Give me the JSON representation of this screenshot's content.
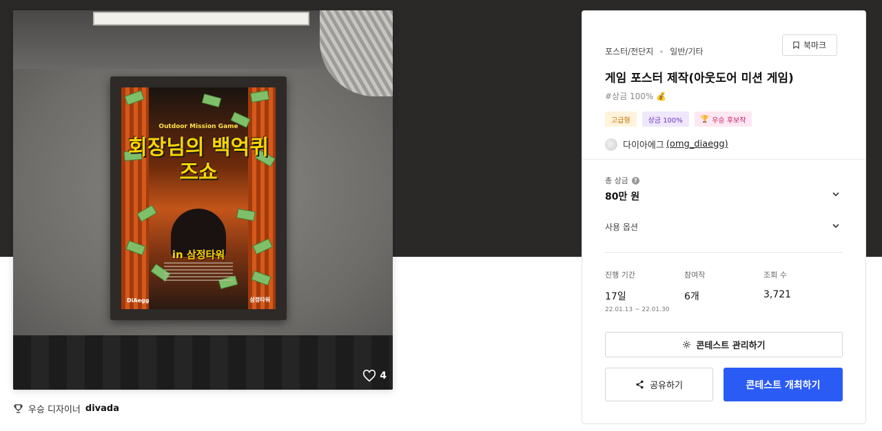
{
  "poster": {
    "subtitle": "Outdoor Mission Game",
    "title": "회장님의 백억퀴즈쇼",
    "location": "in 삼정타워",
    "brand_left": "DiAegg",
    "brand_right": "삼정타워"
  },
  "likes": {
    "count": "4"
  },
  "winner": {
    "label": "우승 디자이너",
    "name": "divada"
  },
  "contest": {
    "category": "포스터/전단지",
    "subcategory": "일반/기타",
    "bookmark_label": "북마크",
    "title": "게임 포스터 제작(아웃도어 미션 게임)",
    "tagline": "#상금 100% 💰",
    "badges": {
      "premium": "고급형",
      "prize": "상금 100%",
      "top": "우승 후보작"
    },
    "host": {
      "name": "다이아에그",
      "handle": "(omg_diaegg)"
    },
    "prize": {
      "label": "총 상금",
      "value": "80만 원"
    },
    "options_label": "사용 옵션",
    "stats": {
      "period_label": "진행 기간",
      "period_value": "17일",
      "period_dates": "22.01.13 ~ 22.01.30",
      "entries_label": "참여작",
      "entries_value": "6개",
      "views_label": "조회 수",
      "views_value": "3,721"
    },
    "manage_label": "콘테스트 관리하기",
    "share_label": "공유하기",
    "host_label": "콘테스트 개최하기"
  },
  "colors": {
    "primary": "#2a5bf5",
    "hero_bg": "#2b2928"
  }
}
